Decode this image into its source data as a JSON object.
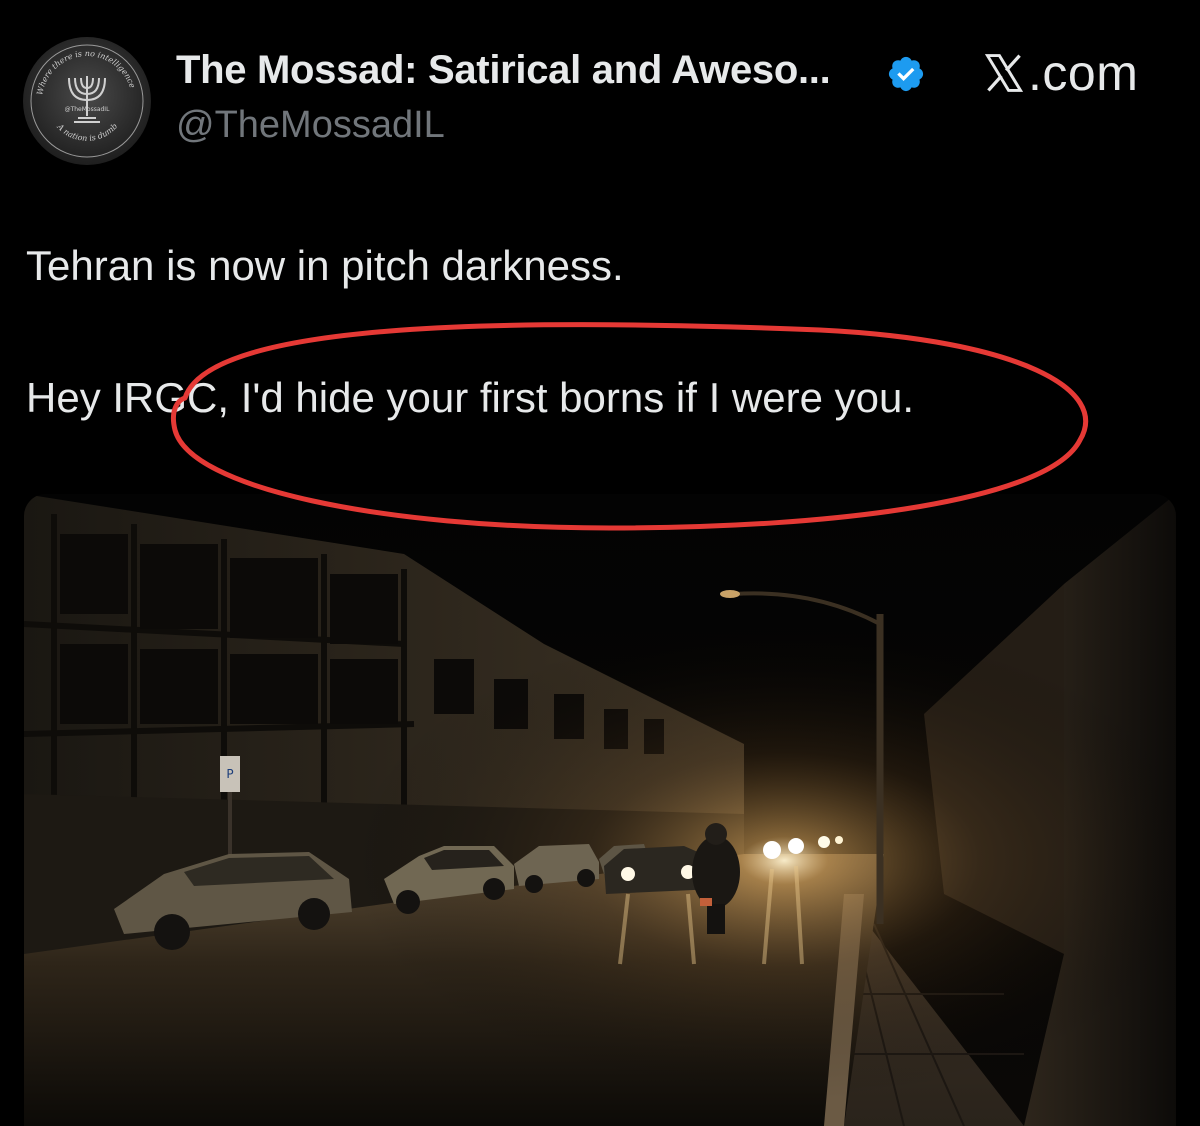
{
  "author": {
    "name": "The Mossad: Satirical and Aweso...",
    "handle": "@TheMossadIL",
    "verified": true,
    "avatar_text_top": "Where there is no intelligence",
    "avatar_text_mid": "@TheMossadIL",
    "avatar_text_bottom": "A nation is dumb"
  },
  "source": {
    "domain": ".com",
    "icon": "x-logo-icon"
  },
  "tweet": {
    "line1": "Tehran is now in pitch darkness.",
    "line2": "Hey IRGC, I'd hide your first borns if I were you."
  },
  "colors": {
    "background": "#000000",
    "text": "#e7e9ea",
    "muted": "#71767b",
    "verified": "#1d9bf0",
    "annotation": "#e53935"
  },
  "media": {
    "icon": "street-at-night-photo",
    "sign_text": "P"
  }
}
